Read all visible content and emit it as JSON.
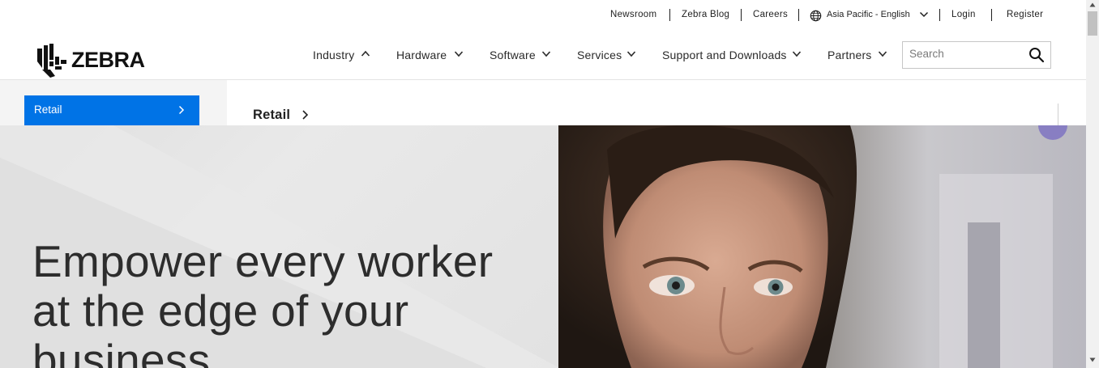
{
  "utility_nav": {
    "newsroom": "Newsroom",
    "blog": "Zebra Blog",
    "careers": "Careers",
    "region": "Asia Pacific - English",
    "login": "Login",
    "register": "Register"
  },
  "brand": {
    "name": "ZEBRA"
  },
  "main_nav": {
    "items": [
      {
        "label": "Industry",
        "state": "expanded"
      },
      {
        "label": "Hardware",
        "state": "collapsed"
      },
      {
        "label": "Software",
        "state": "collapsed"
      },
      {
        "label": "Services",
        "state": "collapsed"
      },
      {
        "label": "Support and Downloads",
        "state": "collapsed"
      },
      {
        "label": "Partners",
        "state": "collapsed"
      }
    ],
    "search_placeholder": "Search"
  },
  "mega_menu": {
    "active_item": "Retail",
    "heading": "Retail"
  },
  "hero": {
    "title": "Empower every worker at the edge of your business"
  },
  "colors": {
    "accent": "#0073e6",
    "hero_bg": "#e4e4e4",
    "text": "#1f1f1f"
  }
}
